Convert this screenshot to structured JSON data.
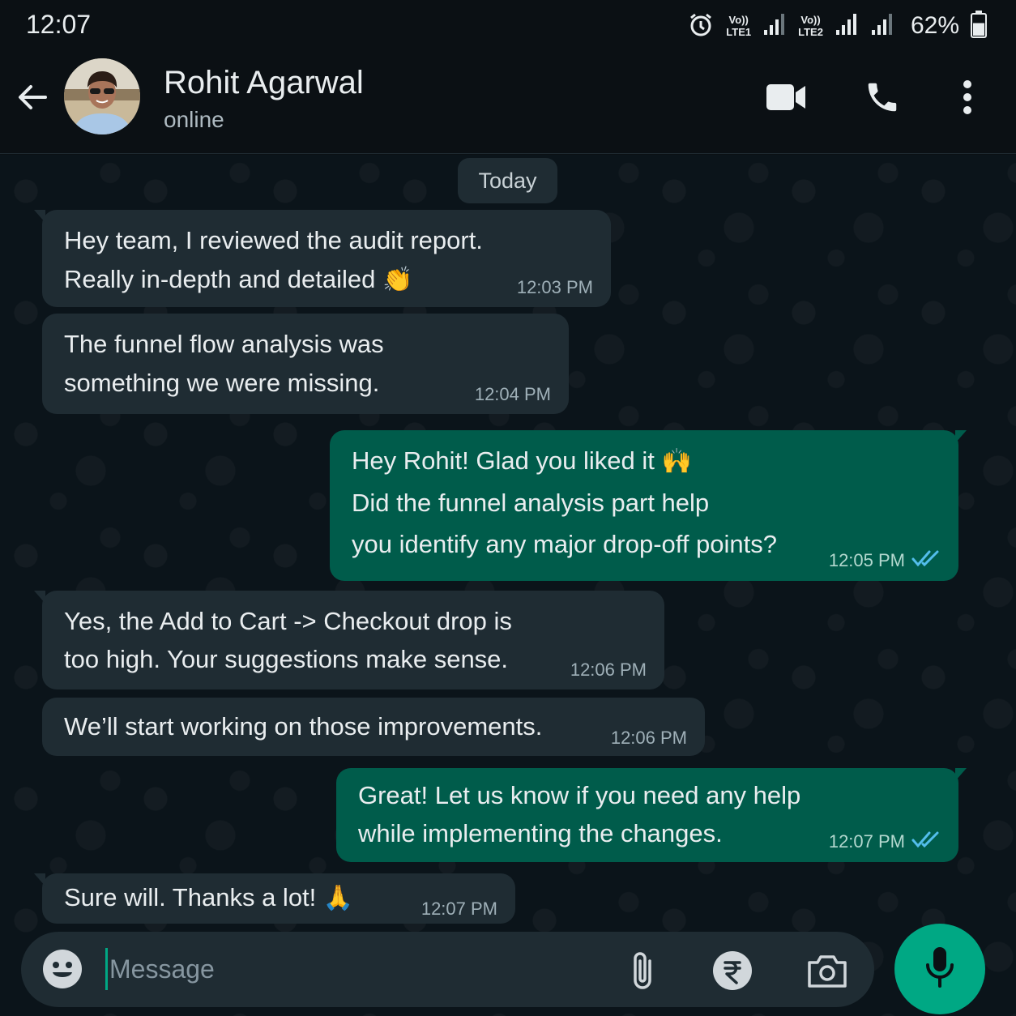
{
  "status_bar": {
    "time": "12:07",
    "sim1_volte": "Vo))",
    "sim1_label": "LTE1",
    "sim2_volte": "Vo))",
    "sim2_label": "LTE2",
    "battery_text": "62%",
    "battery_level": 0.62,
    "icons": [
      "alarm-icon",
      "signal-icon",
      "signal-icon",
      "signal-icon",
      "battery-icon"
    ]
  },
  "header": {
    "contact_name": "Rohit Agarwal",
    "contact_status": "online",
    "icons": [
      "back-arrow-icon",
      "avatar",
      "video-call-icon",
      "phone-icon",
      "more-vert-icon"
    ]
  },
  "chat": {
    "date_chip": "Today",
    "messages": [
      {
        "direction": "in",
        "text": "Hey team, I reviewed the audit report.\nReally in-depth and detailed",
        "emoji": "👏",
        "time": "12:03 PM"
      },
      {
        "direction": "in",
        "text": "The funnel flow analysis was\nsomething we were missing.",
        "time": "12:04 PM"
      },
      {
        "direction": "out",
        "text_line1": "Hey Rohit! Glad you liked it",
        "emoji": "🙌",
        "text_rest": "Did the funnel analysis part help\nyou identify any major drop-off points?",
        "time": "12:05 PM",
        "read": true
      },
      {
        "direction": "in",
        "text": "Yes, the Add to Cart -> Checkout drop is\ntoo high. Your suggestions make sense.",
        "time": "12:06 PM"
      },
      {
        "direction": "in",
        "text": "We’ll start working on those improvements.",
        "time": "12:06 PM"
      },
      {
        "direction": "out",
        "text": "Great! Let us know if you need any help\nwhile implementing the changes.",
        "time": "12:07 PM",
        "read": true
      },
      {
        "direction": "in",
        "text": "Sure will. Thanks a lot!",
        "emoji": "🙏",
        "time": "12:07 PM"
      }
    ]
  },
  "composer": {
    "placeholder": "Message",
    "value": "",
    "icons": [
      "emoji-icon",
      "attach-icon",
      "rupee-payment-icon",
      "camera-icon",
      "mic-icon"
    ]
  },
  "colors": {
    "background": "#0b141a",
    "incoming_bubble": "#1f2c33",
    "outgoing_bubble": "#005c4b",
    "accent": "#00a884",
    "read_ticks": "#53bdeb"
  }
}
